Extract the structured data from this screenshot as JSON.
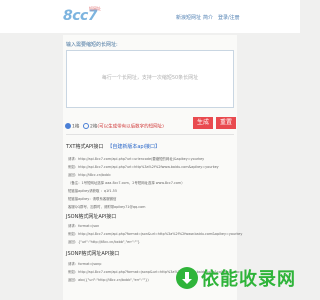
{
  "header": {
    "logo_text": "8cc7",
    "logo_sub": "短网址",
    "nav": [
      "新浪短网址",
      "简介",
      "登录/注册"
    ]
  },
  "form": {
    "label": "输入需要缩短的长网址:",
    "placeholder": "每行一个长网址，支持一次缩短50条长网址",
    "option1": "1格",
    "option2": "2格",
    "option2_hint": "(可以生成带有以后数字的短网址)",
    "generate": "生成",
    "reset": "重置"
  },
  "api": {
    "txt_title": "TXT格式API接口",
    "txt_link": "【自建新版本api接口】",
    "txt_lines": [
      "请求：http://api.8cc7.com/api.php?url=urlencode(要缩短的网址)&apikey=yourkey",
      "例如：http://api.8cc7.com/api.php?url=http%3a%2f%2fwww.baidu.com&apikey=yourkey",
      "返回：http://t8cc.cn/bxbb",
      "（备注：1号短网址选择 aaa.8cc7.com，2号短网址选择 www.8cc7.com）",
      "短链接apikey请获取 ：q1f1.55",
      "短链接apikey：请联系客服微信",
      "客服QQ群号，加群时，请附带apikey71@qq.com"
    ],
    "json_title": "JSON格式网址API接口",
    "json_lines": [
      "请求：format=json",
      "例如：http://api.8cc7.com/api.php?format=json&url=http%3a%2f%2fwww.baidu.com&apikey=yourkey",
      "返回：{\"url\":\"http://t8cc.cn/bxbb\",\"err\":\"\"}"
    ],
    "jsonp_title": "JSONP格式网址API接口",
    "jsonp_lines": [
      "请求：format=jsonp",
      "例如：http://api.8cc7.com/api.php?format=jsonp&url=http%3a%2f%2fwww.baidu.com&callback=abc",
      "返回：abc({\"url\":\"http://t8cc.cn/bxbb\",\"err\":\"\"})"
    ]
  },
  "download": {
    "label": "依能收录网"
  }
}
